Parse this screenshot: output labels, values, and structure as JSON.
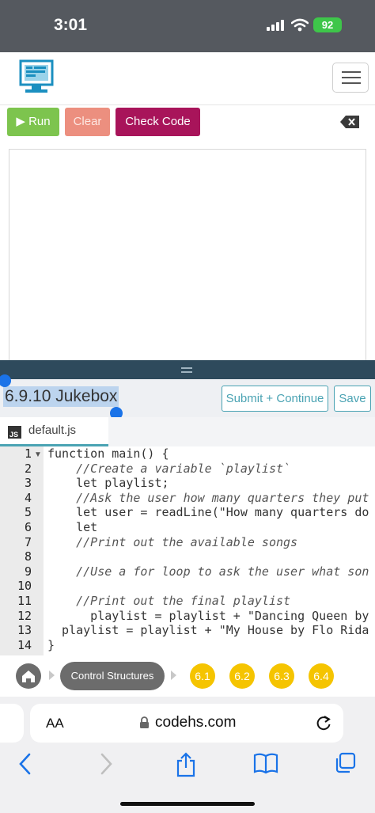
{
  "status": {
    "time": "3:01",
    "battery": "92"
  },
  "toolbar": {
    "run_label": "Run",
    "clear_label": "Clear",
    "check_label": "Check Code"
  },
  "exercise": {
    "title": "6.9.10 Jukebox",
    "submit_label": "Submit + Continue",
    "save_label": "Save"
  },
  "file_tab": {
    "badge": "JS",
    "name": "default.js"
  },
  "editor": {
    "line_numbers": [
      "1",
      "2",
      "3",
      "4",
      "5",
      "6",
      "7",
      "8",
      "9",
      "10",
      "11",
      "12",
      "13",
      "14"
    ],
    "lines": [
      "function main() {",
      "    //Create a variable `playlist`",
      "    let playlist;",
      "    //Ask the user how many quarters they put",
      "    let user = readLine(\"How many quarters do",
      "    let",
      "    //Print out the available songs",
      "",
      "    //Use a for loop to ask the user what son",
      "",
      "    //Print out the final playlist",
      "      playlist = playlist + \"Dancing Queen by",
      "  playlist = playlist + \"My House by Flo Rida",
      "}"
    ]
  },
  "breadcrumb": {
    "section": "Control Structures",
    "lessons": [
      "6.1",
      "6.2",
      "6.3",
      "6.4"
    ]
  },
  "browser": {
    "aa": "AA",
    "url": "codehs.com"
  }
}
